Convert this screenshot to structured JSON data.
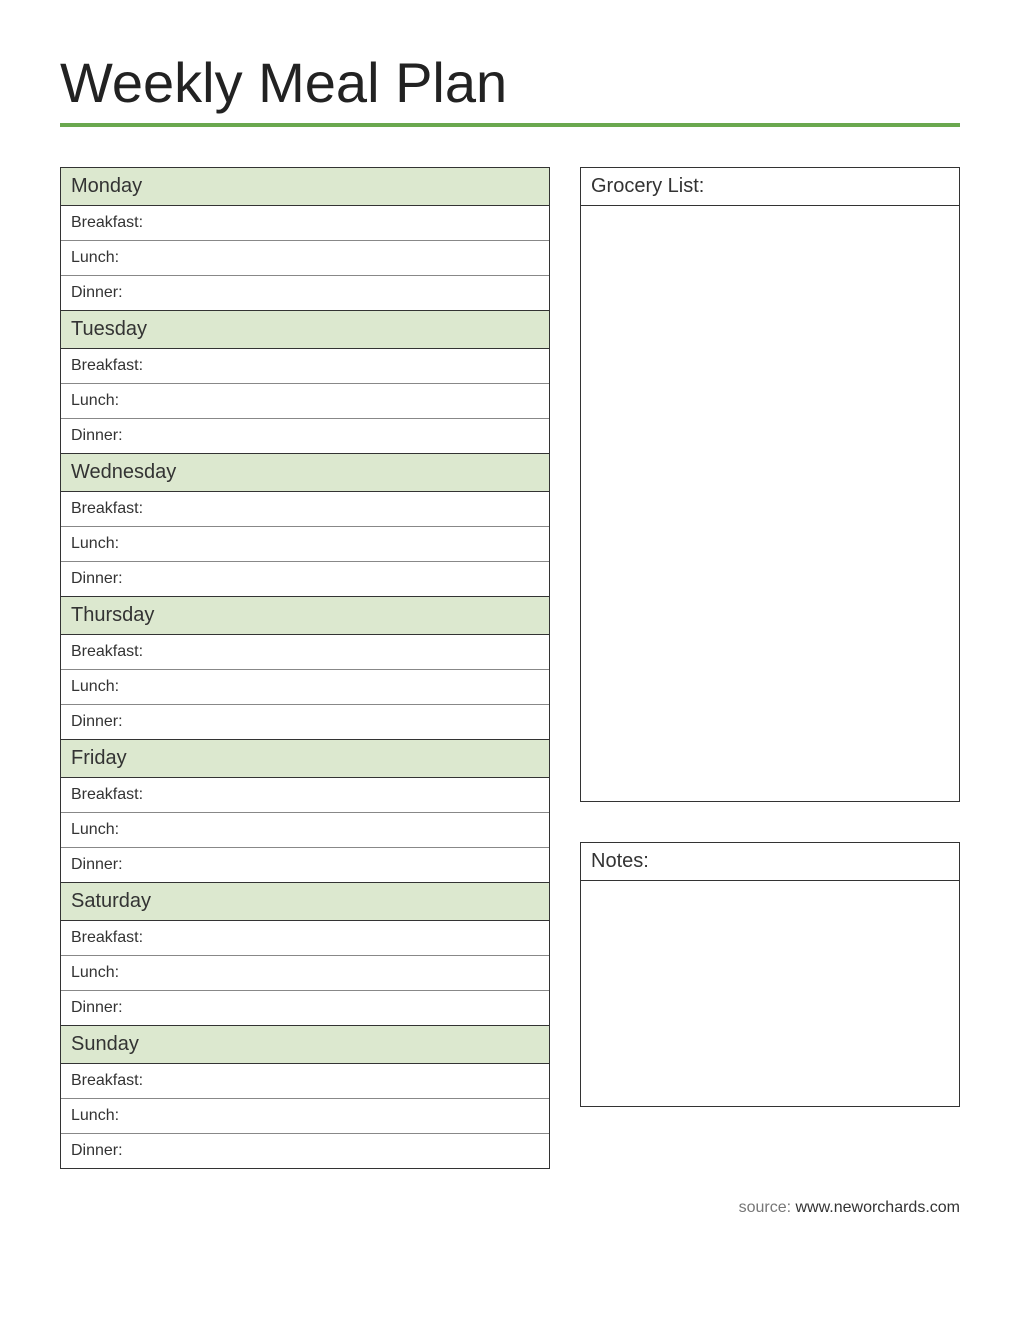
{
  "title": "Weekly Meal Plan",
  "days": [
    {
      "name": "Monday",
      "meals": [
        "Breakfast:",
        "Lunch:",
        "Dinner:"
      ]
    },
    {
      "name": "Tuesday",
      "meals": [
        "Breakfast:",
        "Lunch:",
        "Dinner:"
      ]
    },
    {
      "name": "Wednesday",
      "meals": [
        "Breakfast:",
        "Lunch:",
        "Dinner:"
      ]
    },
    {
      "name": "Thursday",
      "meals": [
        "Breakfast:",
        "Lunch:",
        "Dinner:"
      ]
    },
    {
      "name": "Friday",
      "meals": [
        "Breakfast:",
        "Lunch:",
        "Dinner:"
      ]
    },
    {
      "name": "Saturday",
      "meals": [
        "Breakfast:",
        "Lunch:",
        "Dinner:"
      ]
    },
    {
      "name": "Sunday",
      "meals": [
        "Breakfast:",
        "Lunch:",
        "Dinner:"
      ]
    }
  ],
  "grocery_list": {
    "label": "Grocery List:"
  },
  "notes": {
    "label": "Notes:"
  },
  "source": {
    "prefix": "source: ",
    "text": "www.neworchards.com"
  },
  "colors": {
    "accent": "#6aa84f",
    "day_bg": "#dce8cf"
  }
}
